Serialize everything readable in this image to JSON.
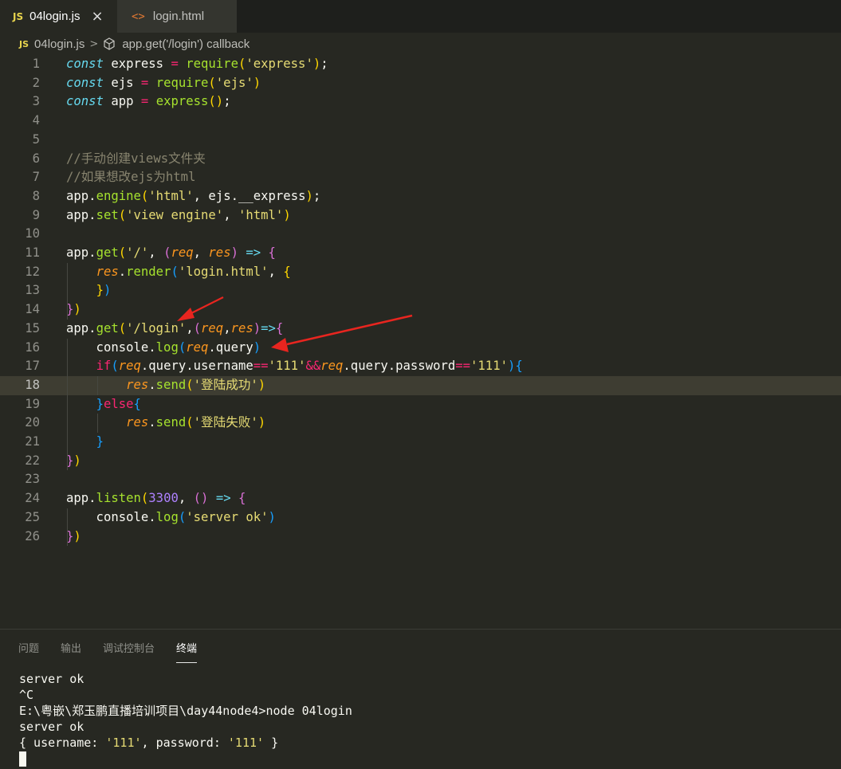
{
  "tabs": [
    {
      "badge": "JS",
      "label": "04login.js",
      "close": "×",
      "active": true
    },
    {
      "badge": "<>",
      "label": "login.html",
      "active": false
    }
  ],
  "breadcrumb": {
    "badge": "JS",
    "file": "04login.js",
    "separator": ">",
    "symbol": "app.get('/login') callback"
  },
  "editor": {
    "current_line": 18,
    "lines": [
      {
        "n": "1",
        "tokens": [
          {
            "t": "const",
            "c": "k"
          },
          {
            "t": " express "
          },
          {
            "t": "=",
            "c": "kw"
          },
          {
            "t": " "
          },
          {
            "t": "require",
            "c": "f"
          },
          {
            "t": "(",
            "c": "y"
          },
          {
            "t": "'express'",
            "c": "s"
          },
          {
            "t": ")",
            "c": "y"
          },
          {
            "t": ";"
          }
        ]
      },
      {
        "n": "2",
        "tokens": [
          {
            "t": "const",
            "c": "k"
          },
          {
            "t": " ejs "
          },
          {
            "t": "=",
            "c": "kw"
          },
          {
            "t": " "
          },
          {
            "t": "require",
            "c": "f"
          },
          {
            "t": "(",
            "c": "y"
          },
          {
            "t": "'ejs'",
            "c": "s"
          },
          {
            "t": ")",
            "c": "y"
          }
        ]
      },
      {
        "n": "3",
        "tokens": [
          {
            "t": "const",
            "c": "k"
          },
          {
            "t": " app "
          },
          {
            "t": "=",
            "c": "kw"
          },
          {
            "t": " "
          },
          {
            "t": "express",
            "c": "f"
          },
          {
            "t": "()",
            "c": "y"
          },
          {
            "t": ";"
          }
        ]
      },
      {
        "n": "4",
        "tokens": []
      },
      {
        "n": "5",
        "tokens": []
      },
      {
        "n": "6",
        "tokens": [
          {
            "t": "//手动创建views文件夹",
            "c": "c"
          }
        ]
      },
      {
        "n": "7",
        "tokens": [
          {
            "t": "//如果想改ejs为html",
            "c": "c"
          }
        ]
      },
      {
        "n": "8",
        "tokens": [
          {
            "t": "app."
          },
          {
            "t": "engine",
            "c": "f"
          },
          {
            "t": "(",
            "c": "y"
          },
          {
            "t": "'html'",
            "c": "s"
          },
          {
            "t": ", ejs.__express"
          },
          {
            "t": ")",
            "c": "y"
          },
          {
            "t": ";"
          }
        ]
      },
      {
        "n": "9",
        "tokens": [
          {
            "t": "app."
          },
          {
            "t": "set",
            "c": "f"
          },
          {
            "t": "(",
            "c": "y"
          },
          {
            "t": "'view engine'",
            "c": "s"
          },
          {
            "t": ", "
          },
          {
            "t": "'html'",
            "c": "s"
          },
          {
            "t": ")",
            "c": "y"
          }
        ]
      },
      {
        "n": "10",
        "tokens": []
      },
      {
        "n": "11",
        "tokens": [
          {
            "t": "app."
          },
          {
            "t": "get",
            "c": "f"
          },
          {
            "t": "(",
            "c": "y"
          },
          {
            "t": "'/'",
            "c": "s"
          },
          {
            "t": ", "
          },
          {
            "t": "(",
            "c": "m"
          },
          {
            "t": "req",
            "c": "p"
          },
          {
            "t": ", "
          },
          {
            "t": "res",
            "c": "p"
          },
          {
            "t": ")",
            "c": "m"
          },
          {
            "t": " "
          },
          {
            "t": "=>",
            "c": "k"
          },
          {
            "t": " "
          },
          {
            "t": "{",
            "c": "m"
          }
        ]
      },
      {
        "n": "12",
        "tokens": [
          {
            "t": "    "
          },
          {
            "t": "res",
            "c": "p"
          },
          {
            "t": "."
          },
          {
            "t": "render",
            "c": "f"
          },
          {
            "t": "(",
            "c": "b"
          },
          {
            "t": "'login.html'",
            "c": "s"
          },
          {
            "t": ", "
          },
          {
            "t": "{",
            "c": "y"
          }
        ]
      },
      {
        "n": "13",
        "tokens": [
          {
            "t": "    "
          },
          {
            "t": "}",
            "c": "y"
          },
          {
            "t": ")",
            "c": "b"
          }
        ]
      },
      {
        "n": "14",
        "tokens": [
          {
            "t": "}",
            "c": "m"
          },
          {
            "t": ")",
            "c": "y"
          }
        ]
      },
      {
        "n": "15",
        "tokens": [
          {
            "t": "app."
          },
          {
            "t": "get",
            "c": "f"
          },
          {
            "t": "(",
            "c": "y"
          },
          {
            "t": "'/login'",
            "c": "s"
          },
          {
            "t": ","
          },
          {
            "t": "(",
            "c": "m"
          },
          {
            "t": "req",
            "c": "p"
          },
          {
            "t": ","
          },
          {
            "t": "res",
            "c": "p"
          },
          {
            "t": ")",
            "c": "m"
          },
          {
            "t": "=>",
            "c": "k"
          },
          {
            "t": "{",
            "c": "m"
          }
        ]
      },
      {
        "n": "16",
        "tokens": [
          {
            "t": "    console."
          },
          {
            "t": "log",
            "c": "f"
          },
          {
            "t": "(",
            "c": "b"
          },
          {
            "t": "req",
            "c": "p"
          },
          {
            "t": ".query"
          },
          {
            "t": ")",
            "c": "b"
          }
        ]
      },
      {
        "n": "17",
        "tokens": [
          {
            "t": "    "
          },
          {
            "t": "if",
            "c": "kw"
          },
          {
            "t": "(",
            "c": "b"
          },
          {
            "t": "req",
            "c": "p"
          },
          {
            "t": ".query.username"
          },
          {
            "t": "==",
            "c": "kw"
          },
          {
            "t": "'111'",
            "c": "s"
          },
          {
            "t": "&&",
            "c": "kw"
          },
          {
            "t": "req",
            "c": "p"
          },
          {
            "t": ".query.password"
          },
          {
            "t": "==",
            "c": "kw"
          },
          {
            "t": "'111'",
            "c": "s"
          },
          {
            "t": ")",
            "c": "b"
          },
          {
            "t": "{",
            "c": "b"
          }
        ]
      },
      {
        "n": "18",
        "tokens": [
          {
            "t": "        "
          },
          {
            "t": "res",
            "c": "p"
          },
          {
            "t": "."
          },
          {
            "t": "send",
            "c": "f"
          },
          {
            "t": "(",
            "c": "y"
          },
          {
            "t": "'登陆成功'",
            "c": "s"
          },
          {
            "t": ")",
            "c": "y"
          }
        ]
      },
      {
        "n": "19",
        "tokens": [
          {
            "t": "    "
          },
          {
            "t": "}",
            "c": "b"
          },
          {
            "t": "else",
            "c": "kw"
          },
          {
            "t": "{",
            "c": "b"
          }
        ]
      },
      {
        "n": "20",
        "tokens": [
          {
            "t": "        "
          },
          {
            "t": "res",
            "c": "p"
          },
          {
            "t": "."
          },
          {
            "t": "send",
            "c": "f"
          },
          {
            "t": "(",
            "c": "y"
          },
          {
            "t": "'登陆失败'",
            "c": "s"
          },
          {
            "t": ")",
            "c": "y"
          }
        ]
      },
      {
        "n": "21",
        "tokens": [
          {
            "t": "    "
          },
          {
            "t": "}",
            "c": "b"
          }
        ]
      },
      {
        "n": "22",
        "tokens": [
          {
            "t": "}",
            "c": "m"
          },
          {
            "t": ")",
            "c": "y"
          }
        ]
      },
      {
        "n": "23",
        "tokens": []
      },
      {
        "n": "24",
        "tokens": [
          {
            "t": "app."
          },
          {
            "t": "listen",
            "c": "f"
          },
          {
            "t": "(",
            "c": "y"
          },
          {
            "t": "3300",
            "c": "n"
          },
          {
            "t": ", "
          },
          {
            "t": "()",
            "c": "m"
          },
          {
            "t": " "
          },
          {
            "t": "=>",
            "c": "k"
          },
          {
            "t": " "
          },
          {
            "t": "{",
            "c": "m"
          }
        ]
      },
      {
        "n": "25",
        "tokens": [
          {
            "t": "    console."
          },
          {
            "t": "log",
            "c": "f"
          },
          {
            "t": "(",
            "c": "b"
          },
          {
            "t": "'server ok'",
            "c": "s"
          },
          {
            "t": ")",
            "c": "b"
          }
        ]
      },
      {
        "n": "26",
        "tokens": [
          {
            "t": "}",
            "c": "m"
          },
          {
            "t": ")",
            "c": "y"
          }
        ]
      }
    ]
  },
  "panel": {
    "tabs": [
      {
        "label": "问题",
        "active": false
      },
      {
        "label": "输出",
        "active": false
      },
      {
        "label": "调试控制台",
        "active": false
      },
      {
        "label": "终端",
        "active": true
      }
    ]
  },
  "terminal": {
    "line1": "server ok",
    "line2": "^C",
    "line3": "E:\\粤嵌\\郑玉鹏直播培训项目\\day44node4>node 04login",
    "line4": "server ok",
    "line5": {
      "open": "{ username: ",
      "v1": "'111'",
      "mid": ", password: ",
      "v2": "'111'",
      "close": " }"
    }
  },
  "colors": {
    "background": "#272822",
    "tab_bar": "#1e1f1c",
    "arrow": "#e8251f",
    "current_line": "#3e3d32"
  }
}
